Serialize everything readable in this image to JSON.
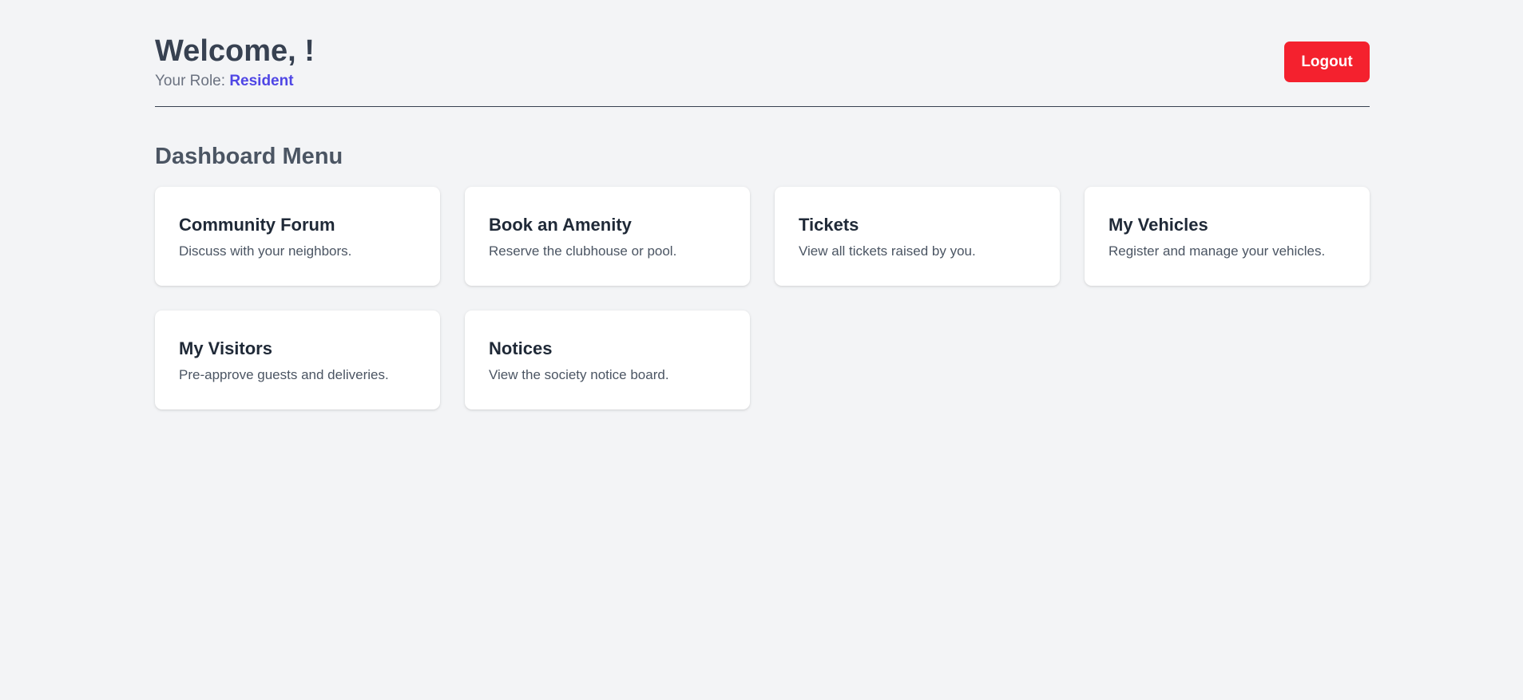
{
  "header": {
    "welcome_text": "Welcome, !",
    "role_label": "Your Role:",
    "role_value": "Resident",
    "logout_label": "Logout"
  },
  "menu": {
    "title": "Dashboard Menu",
    "cards": [
      {
        "title": "Community Forum",
        "description": "Discuss with your neighbors."
      },
      {
        "title": "Book an Amenity",
        "description": "Reserve the clubhouse or pool."
      },
      {
        "title": "Tickets",
        "description": "View all tickets raised by you."
      },
      {
        "title": "My Vehicles",
        "description": "Register and manage your vehicles."
      },
      {
        "title": "My Visitors",
        "description": "Pre-approve guests and deliveries."
      },
      {
        "title": "Notices",
        "description": "View the society notice board."
      }
    ]
  },
  "colors": {
    "background": "#f3f4f6",
    "logout": "#f4212e",
    "role_accent": "#4f46e5"
  }
}
